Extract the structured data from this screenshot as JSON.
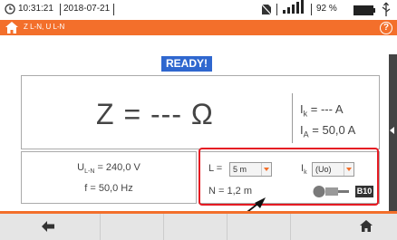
{
  "status": {
    "time": "10:31:21",
    "date": "2018-07-21",
    "battery": "92 %"
  },
  "title": {
    "label": "Z L-N, U L-N"
  },
  "ready_label": "READY!",
  "result": {
    "main": "Z = --- Ω",
    "ik": "= --- A",
    "ia": "= 50,0 A"
  },
  "voltages": {
    "uln": "= 240,0 V",
    "f": "f = 50,0 Hz"
  },
  "settings": {
    "L_label": "L =",
    "L_value": "5 m",
    "ik_value": "(Uo)",
    "N_label": "N = 1,2 m",
    "fuse_type": "B10"
  },
  "colors": {
    "accent": "#f36f2b",
    "ready": "#2f67cf",
    "highlight": "#e51b23"
  },
  "icons": [
    "clock-icon",
    "no-sim-icon",
    "signal-icon",
    "battery-icon",
    "usb-icon",
    "home-icon",
    "help-icon",
    "back-arrow-icon",
    "fuse-icon",
    "sidebar-arrow-icon"
  ]
}
